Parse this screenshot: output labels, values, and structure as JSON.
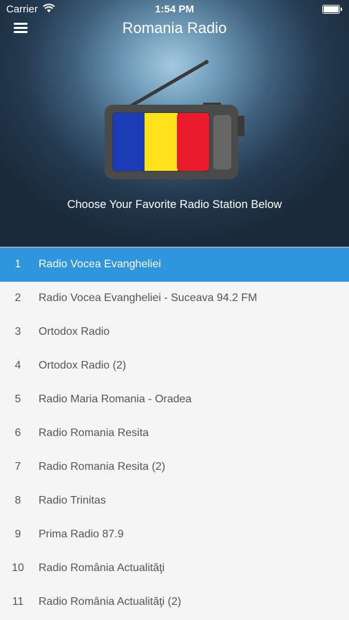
{
  "status_bar": {
    "carrier": "Carrier",
    "time": "1:54 PM",
    "icons": [
      "wifi-icon",
      "battery-icon"
    ]
  },
  "header": {
    "title": "Romania Radio",
    "menu_icon": "hamburger-menu-icon",
    "subtitle": "Choose Your Favorite Radio Station Below"
  },
  "hero": {
    "illustration": "radio-with-romanian-flag",
    "flag_colors": [
      "#1a3cb5",
      "#ffe21c",
      "#ea1c2c"
    ]
  },
  "colors": {
    "accent": "#2f95dc",
    "list_background": "#f5f5f5",
    "list_text": "#555555"
  },
  "stations": [
    {
      "num": "1",
      "name": "Radio Vocea Evangheliei",
      "selected": true
    },
    {
      "num": "2",
      "name": "Radio Vocea Evangheliei - Suceava 94.2 FM",
      "selected": false
    },
    {
      "num": "3",
      "name": "Ortodox Radio",
      "selected": false
    },
    {
      "num": "4",
      "name": "Ortodox Radio (2)",
      "selected": false
    },
    {
      "num": "5",
      "name": "Radio Maria Romania - Oradea",
      "selected": false
    },
    {
      "num": "6",
      "name": "Radio Romania Resita",
      "selected": false
    },
    {
      "num": "7",
      "name": "Radio Romania Resita (2)",
      "selected": false
    },
    {
      "num": "8",
      "name": "Radio Trinitas",
      "selected": false
    },
    {
      "num": "9",
      "name": "Prima Radio 87.9",
      "selected": false
    },
    {
      "num": "10",
      "name": "Radio România Actualităţi",
      "selected": false
    },
    {
      "num": "11",
      "name": "Radio România Actualităţi (2)",
      "selected": false
    }
  ]
}
